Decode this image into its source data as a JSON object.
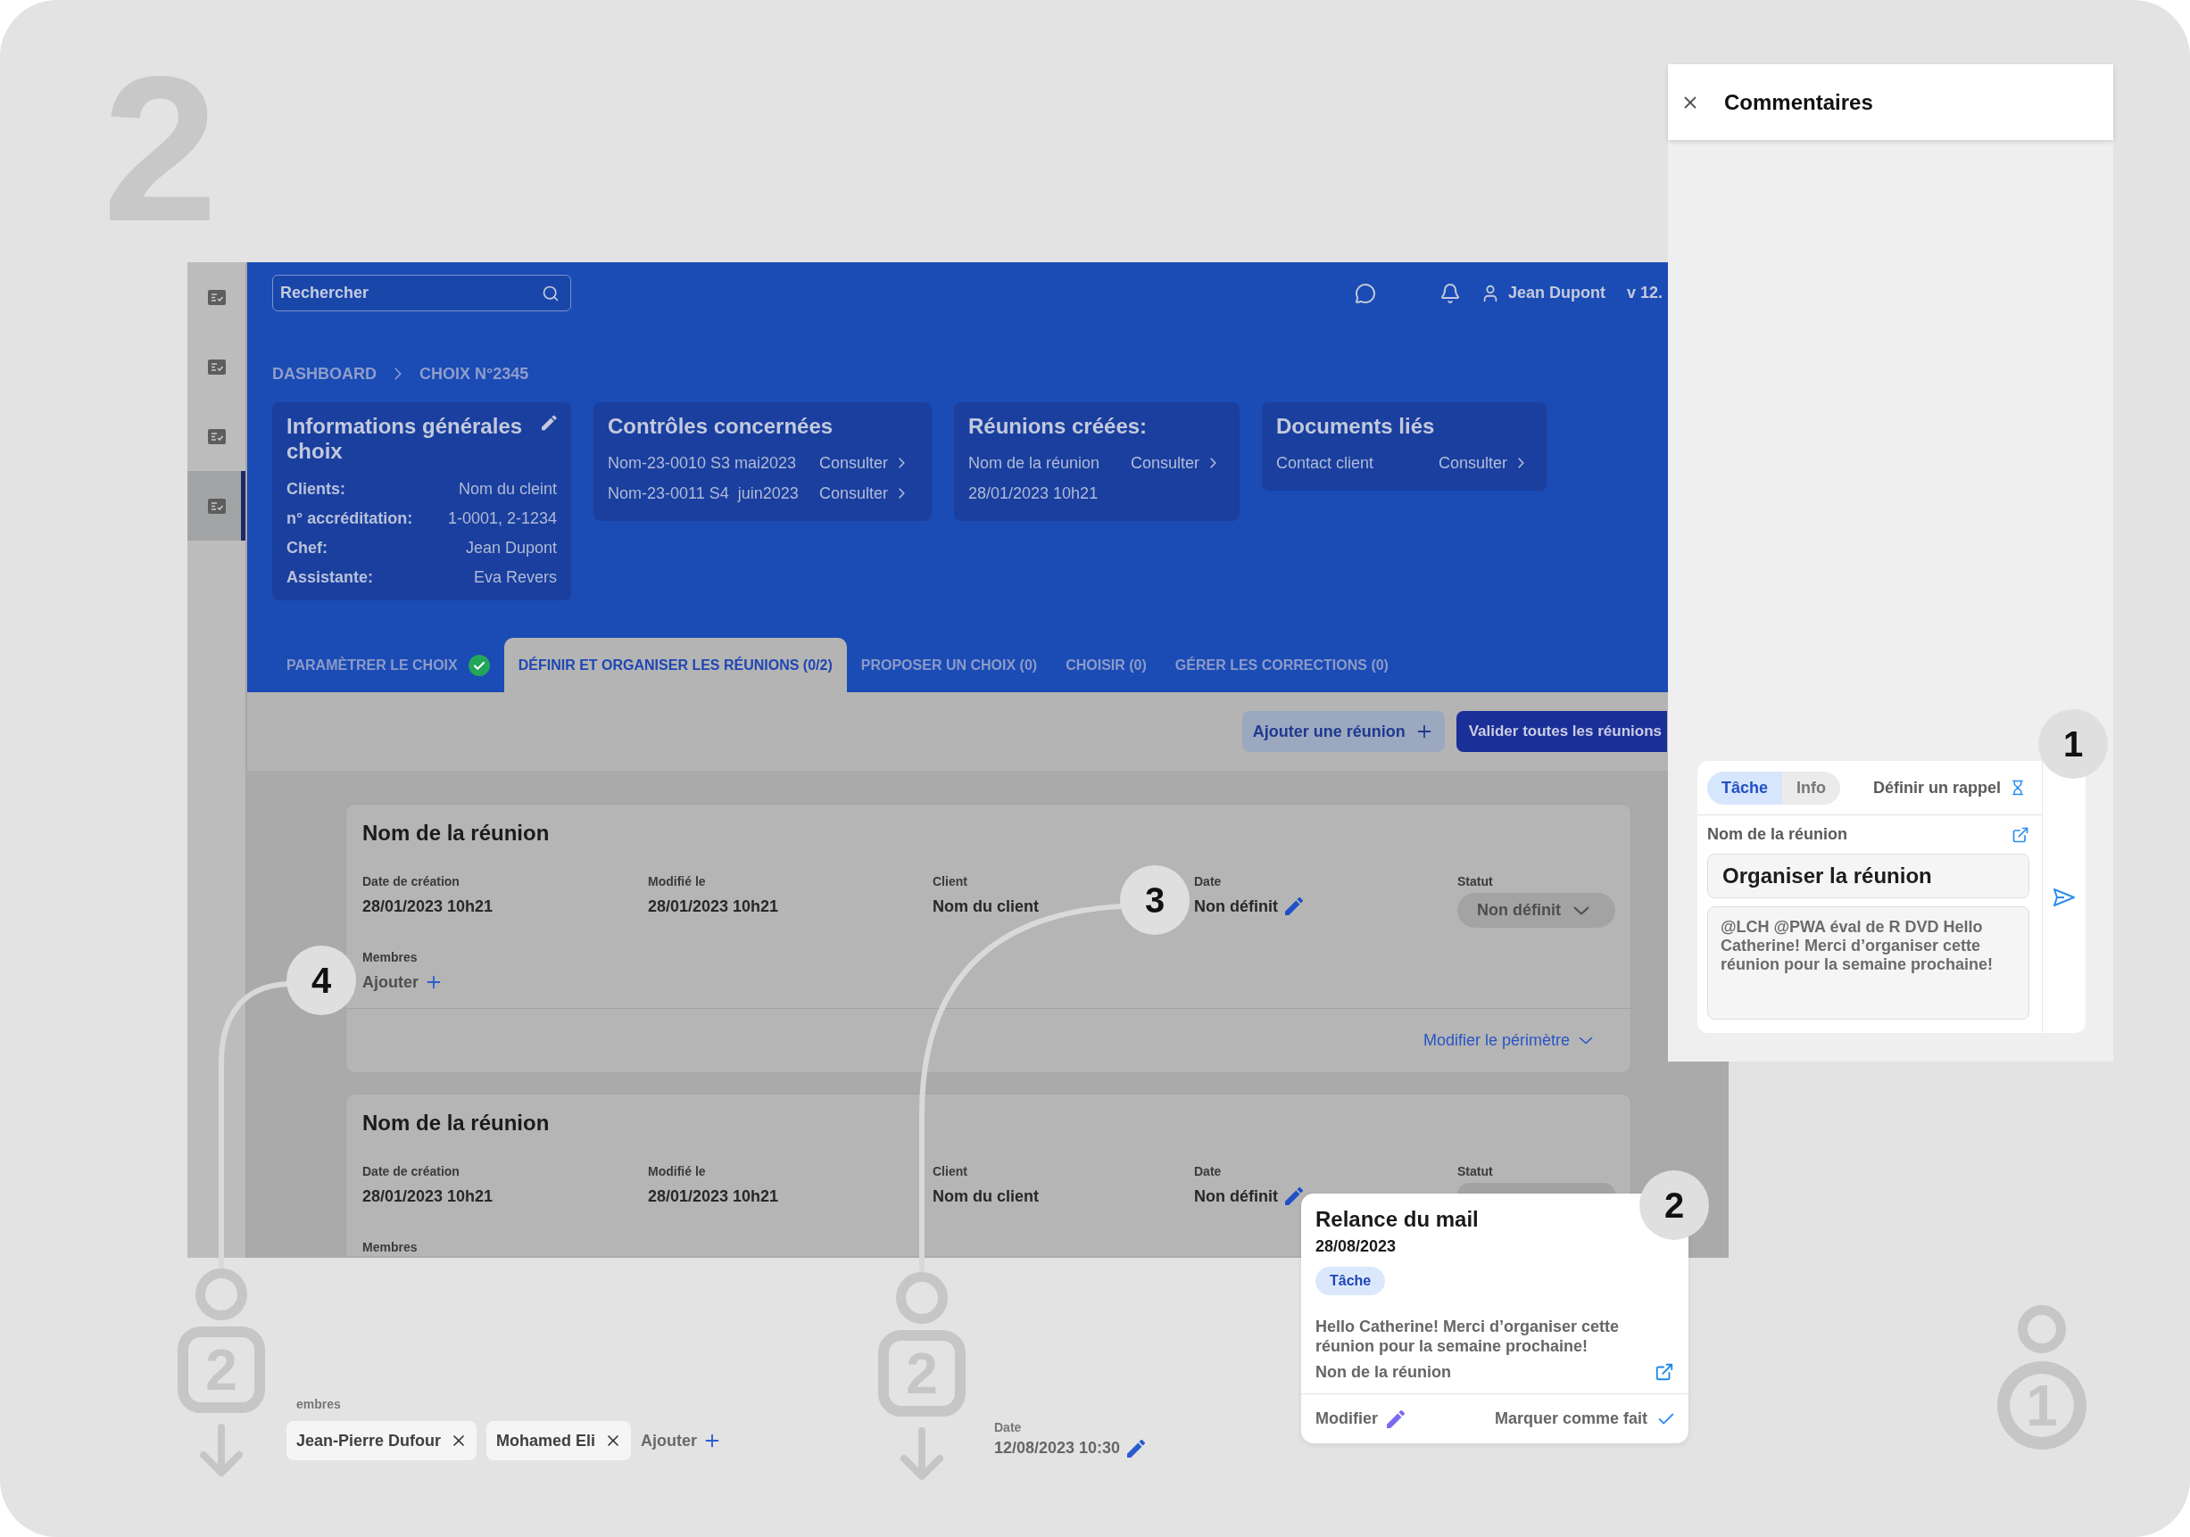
{
  "slide_number": "2",
  "app": {
    "sidebar": [
      {
        "selected": false
      },
      {
        "selected": false
      },
      {
        "selected": false
      },
      {
        "selected": true
      }
    ],
    "search": {
      "placeholder": "Rechercher"
    },
    "user_name": "Jean Dupont",
    "version": "v 12.",
    "breadcrumb": [
      "DASHBOARD",
      "CHOIX N°2345"
    ],
    "info_cards": [
      {
        "kind": "details",
        "title": "Informations générales choix",
        "rows": [
          {
            "label": "Clients:",
            "value": "Nom du cleint"
          },
          {
            "label": "n° accréditation:",
            "value": "1-0001, 2-1234"
          },
          {
            "label": "Chef:",
            "value": "Jean Dupont"
          },
          {
            "label": "Assistante:",
            "value": "Eva Revers"
          }
        ]
      },
      {
        "kind": "links",
        "title": "Contrôles concernées",
        "rows": [
          {
            "text": "Nom-23-0010 S3 mai2023",
            "link": "Consulter"
          },
          {
            "text": "Nom-23-0011 S4  juin2023",
            "link": "Consulter"
          }
        ]
      },
      {
        "kind": "links",
        "title": "Réunions créées:",
        "rows": [
          {
            "text": "Nom de la réunion",
            "link": "Consulter"
          },
          {
            "text": "28/01/2023 10h21"
          }
        ]
      },
      {
        "kind": "links",
        "title": "Documents liés",
        "rows": [
          {
            "text": "Contact client",
            "link": "Consulter"
          }
        ]
      }
    ],
    "tabs": [
      {
        "label": "PARAMÈTRER LE CHOIX",
        "selected": false,
        "done": true
      },
      {
        "label": "DÉFINIR ET ORGANISER LES RÉUNIONS (0/2)",
        "selected": true,
        "done": false
      },
      {
        "label": "PROPOSER UN CHOIX (0)",
        "selected": false,
        "done": false
      },
      {
        "label": "CHOISIR (0)",
        "selected": false,
        "done": false
      },
      {
        "label": "GÉRER LES CORRECTIONS (0)",
        "selected": false,
        "done": false
      }
    ],
    "actions": [
      {
        "kind": "secondary",
        "label": "Ajouter une réunion"
      },
      {
        "kind": "primary",
        "label": "Valider toutes les réunions"
      }
    ],
    "meetings": [
      {
        "title": "Nom de la réunion",
        "fields": [
          {
            "kind": "text",
            "label": "Date de création",
            "value": "28/01/2023 10h21"
          },
          {
            "kind": "text",
            "label": "Modifié le",
            "value": "28/01/2023 10h21"
          },
          {
            "kind": "text",
            "label": "Client",
            "value": "Nom du client"
          },
          {
            "kind": "editable",
            "label": "Date",
            "value": "Non définit"
          },
          {
            "kind": "select",
            "label": "Statut",
            "value": "Non définit"
          }
        ],
        "members": {
          "label": "Membres",
          "add_label": "Ajouter"
        },
        "footer_link": "Modifier le périmètre"
      },
      {
        "title": "Nom de la réunion",
        "fields": [
          {
            "kind": "text",
            "label": "Date de création",
            "value": "28/01/2023 10h21"
          },
          {
            "kind": "text",
            "label": "Modifié le",
            "value": "28/01/2023 10h21"
          },
          {
            "kind": "text",
            "label": "Client",
            "value": "Nom du client"
          },
          {
            "kind": "editable",
            "label": "Date",
            "value": "Non définit"
          },
          {
            "kind": "select",
            "label": "Statut"
          }
        ],
        "members": {
          "label": "Membres"
        }
      }
    ]
  },
  "comments": {
    "title": "Commentaires",
    "composer": {
      "types": [
        {
          "label": "Tâche",
          "selected": true
        },
        {
          "label": "Info",
          "selected": false
        }
      ],
      "reminder": "Définir un rappel",
      "field_label": "Nom de la réunion",
      "title_value": "Organiser la réunion",
      "message": "@LCH @PWA éval de R DVD Hello Catherine! Merci d’organiser cette réunion pour la semaine prochaine!"
    }
  },
  "reminder_card": {
    "title": "Relance du mail",
    "date": "28/08/2023",
    "tag": "Tâche",
    "message": "Hello Catherine! Merci d’organiser cette réunion pour la semaine prochaine!",
    "link": "Non de la réunion",
    "edit": "Modifier",
    "done": "Marquer comme fait"
  },
  "members_detail": {
    "label": "embres",
    "chips": [
      "Jean-Pierre Dufour",
      "Mohamed Eli"
    ],
    "add_label": "Ajouter"
  },
  "date_detail": {
    "label": "Date",
    "value": "12/08/2023 10:30"
  },
  "markers": [
    {
      "kind": "square",
      "number": "2"
    },
    {
      "kind": "square",
      "number": "2"
    },
    {
      "kind": "circle",
      "number": "1"
    }
  ],
  "callouts": [
    "1",
    "2",
    "3",
    "4"
  ]
}
